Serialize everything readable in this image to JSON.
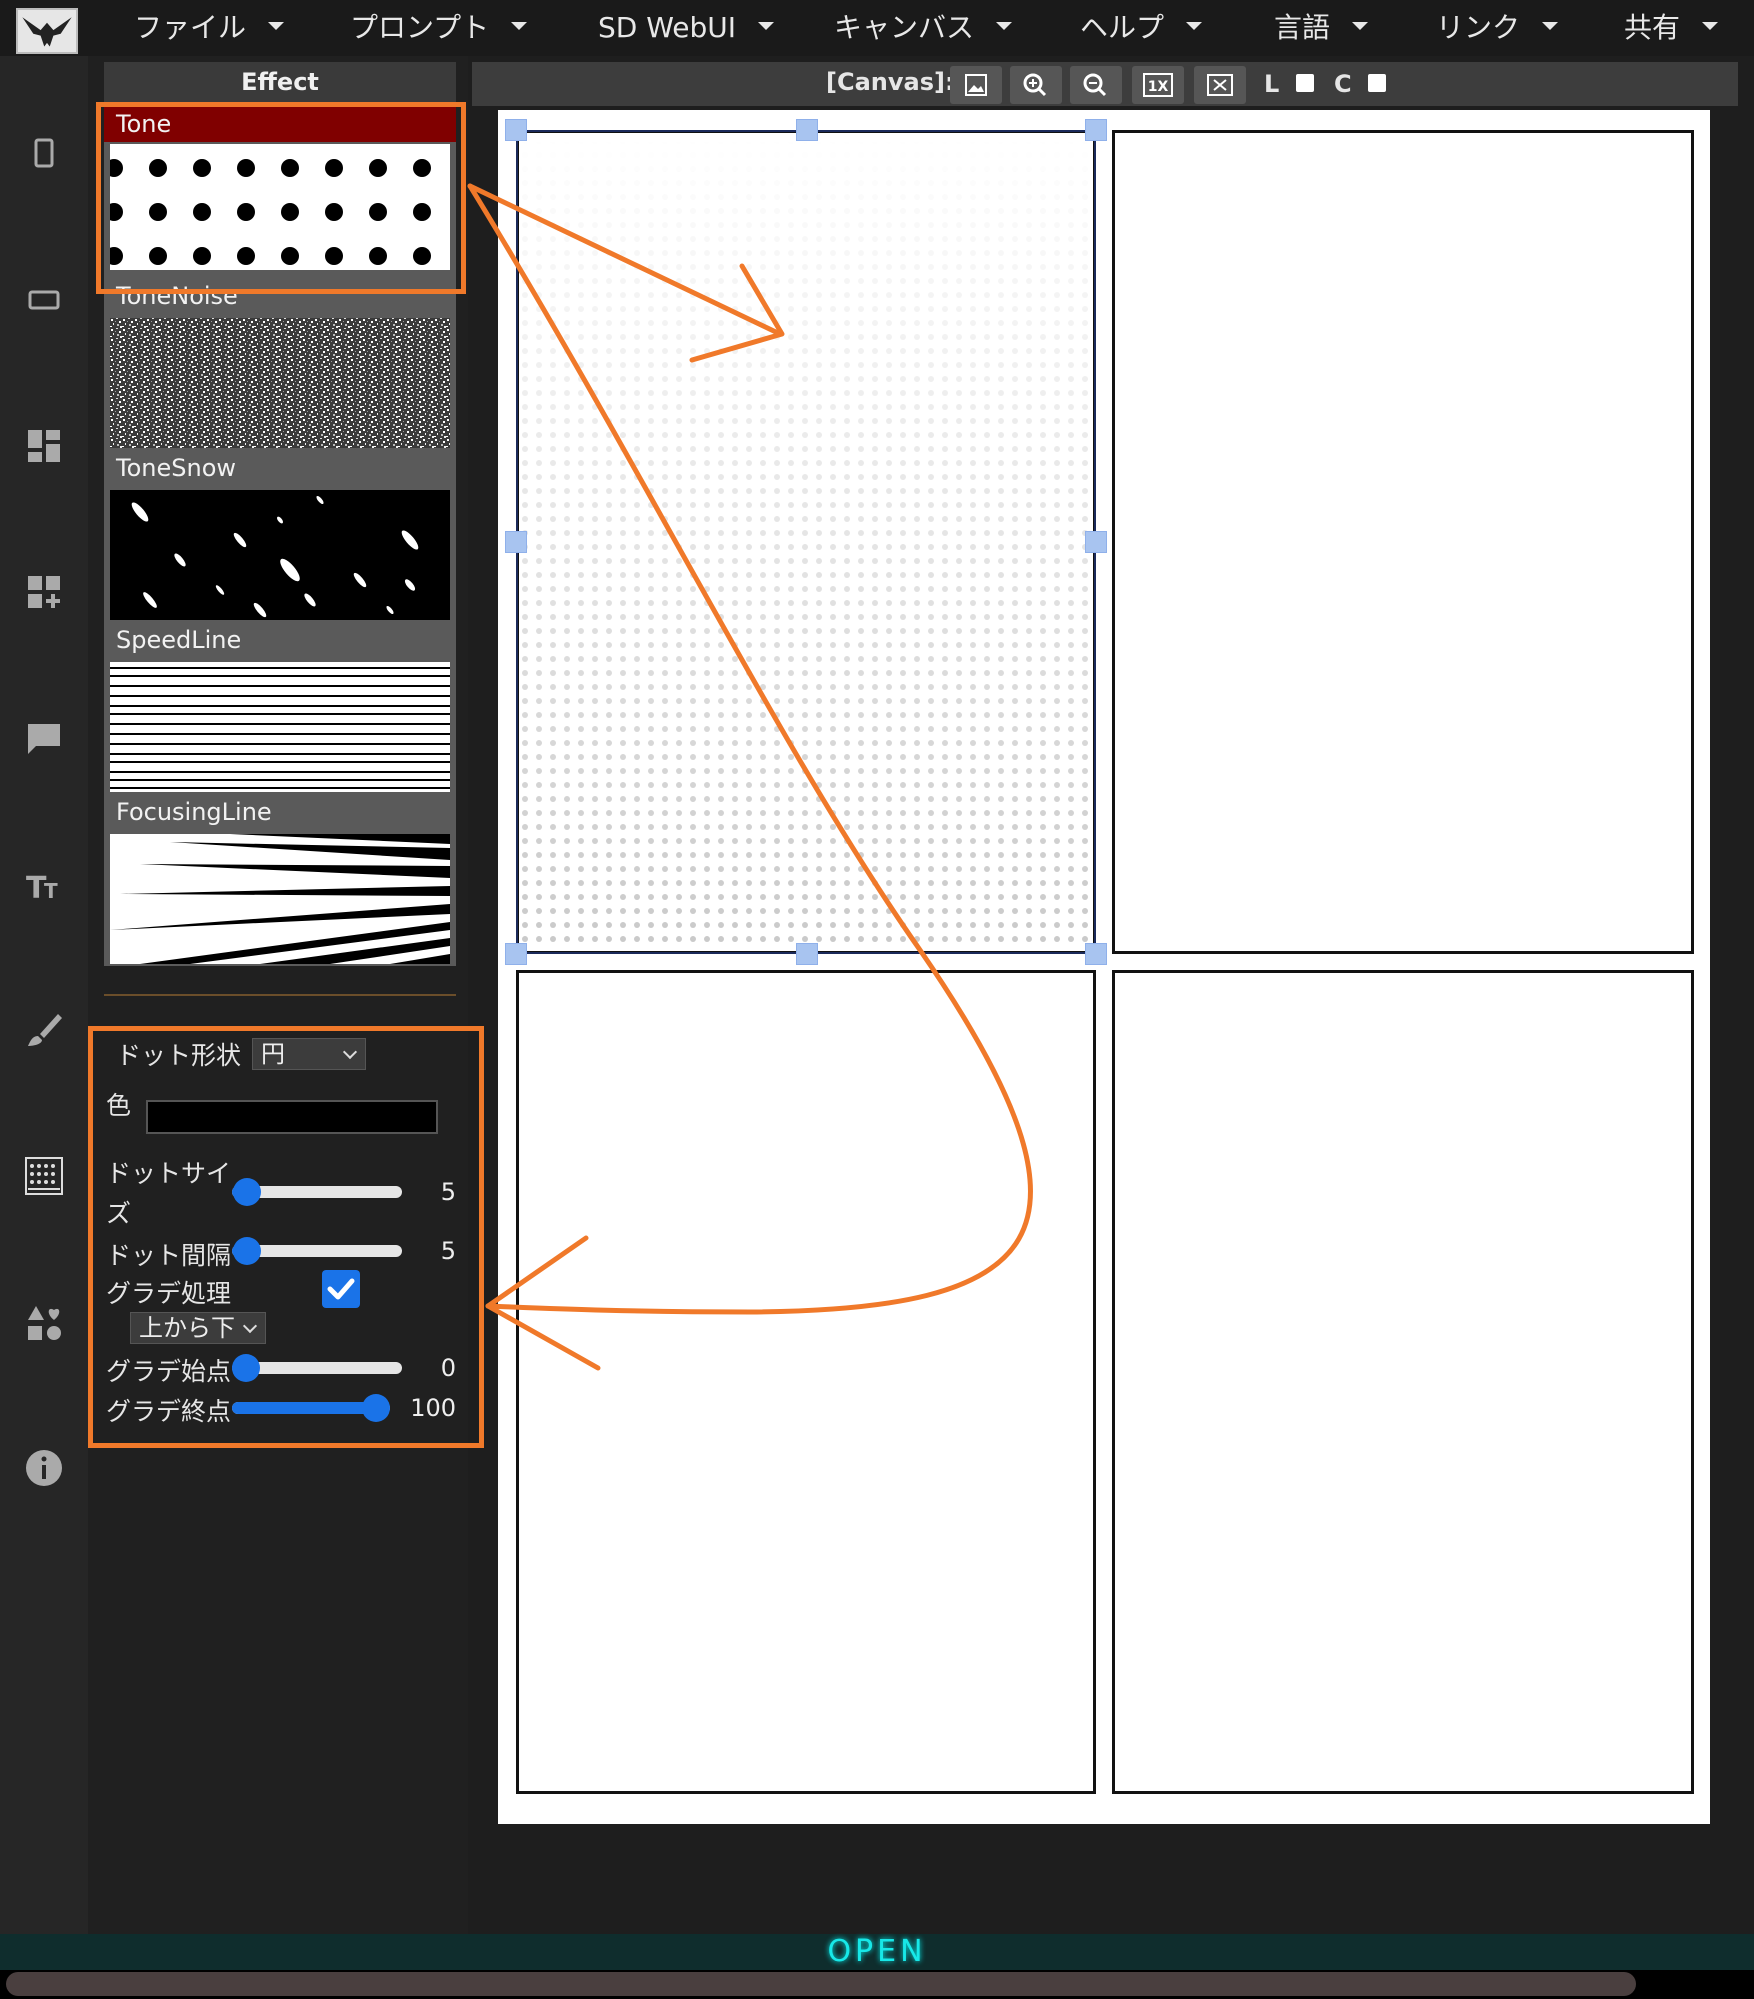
{
  "menu": [
    {
      "label": "ファイル"
    },
    {
      "label": "プロンプト"
    },
    {
      "label": "SD WebUI"
    },
    {
      "label": "キャンバス"
    },
    {
      "label": "ヘルプ"
    },
    {
      "label": "言語"
    },
    {
      "label": "リンク"
    },
    {
      "label": "共有"
    }
  ],
  "sidebar": {
    "icons": [
      "page-portrait-icon",
      "page-landscape-icon",
      "panel-layout-icon",
      "add-panel-icon",
      "speech-bubble-icon",
      "text-icon",
      "brush-icon",
      "tone-icon",
      "shapes-icon",
      "info-icon"
    ]
  },
  "effect_panel": {
    "title": "Effect",
    "items": [
      {
        "label": "Tone"
      },
      {
        "label": "ToneNoise"
      },
      {
        "label": "ToneSnow"
      },
      {
        "label": "SpeedLine"
      },
      {
        "label": "FocusingLine"
      }
    ],
    "selected": "Tone"
  },
  "settings": {
    "dot_shape_label": "ドット形状",
    "dot_shape_value": "円",
    "color_label": "色",
    "color_value": "#000000",
    "dot_size_label_1": "ドットサイ",
    "dot_size_label_2": "ズ",
    "dot_size_value": "5",
    "dot_size_fraction": 0.09,
    "dot_spacing_label": "ドット間隔",
    "dot_spacing_value": "5",
    "dot_spacing_fraction": 0.09,
    "gradient_label": "グラデ処理",
    "gradient_checked": true,
    "gradient_direction": "上から下",
    "gradient_start_label": "グラデ始点",
    "gradient_start_value": "0",
    "gradient_start_fraction": 0.0,
    "gradient_end_label": "グラデ終点",
    "gradient_end_value": "100",
    "gradient_end_fraction": 1.0
  },
  "canvas_toolbar": {
    "label": "[Canvas]:",
    "buttons": [
      "image-icon",
      "zoom-in-icon",
      "zoom-out-icon",
      "zoom-1x-icon",
      "close-canvas-icon"
    ],
    "zoom_1x_text": "1X",
    "l_label": "L",
    "c_label": "C"
  },
  "status": {
    "open_text": "OPEN"
  },
  "colors": {
    "accent": "#1a73e8",
    "annotation": "#f0792a",
    "tone_header": "#800000",
    "open_glow": "#17e8e8"
  }
}
